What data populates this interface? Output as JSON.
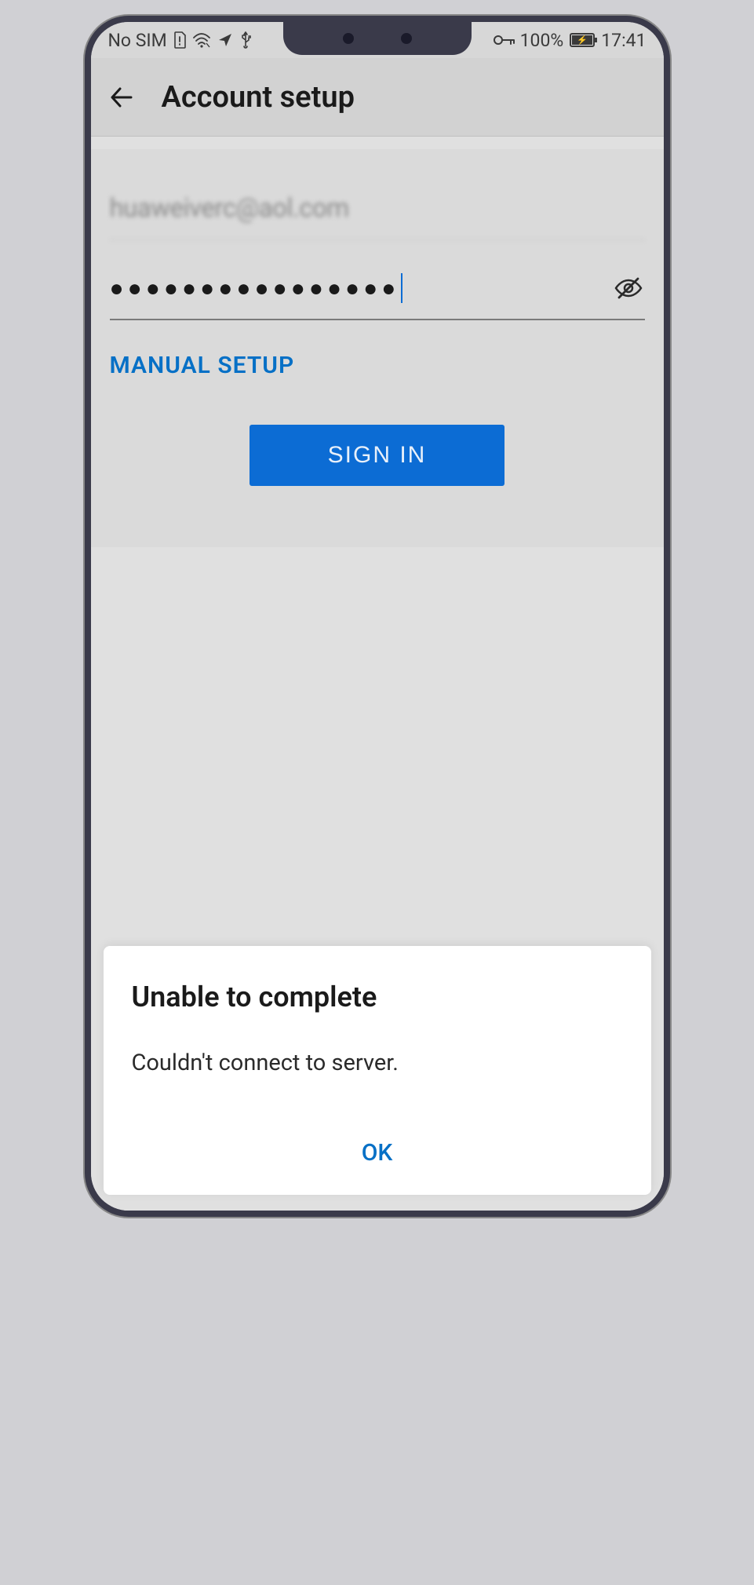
{
  "status_bar": {
    "sim": "No SIM",
    "key_icon": "⚿",
    "battery_pct": "100%",
    "time": "17:41"
  },
  "header": {
    "title": "Account setup"
  },
  "form": {
    "email": "huaweiverc@aol.com",
    "password_dots": "●●●●●●●●●●●●●●●●",
    "manual_setup_label": "MANUAL SETUP",
    "signin_label": "SIGN IN"
  },
  "dialog": {
    "title": "Unable to complete",
    "message": "Couldn't connect to server.",
    "ok_label": "OK"
  }
}
